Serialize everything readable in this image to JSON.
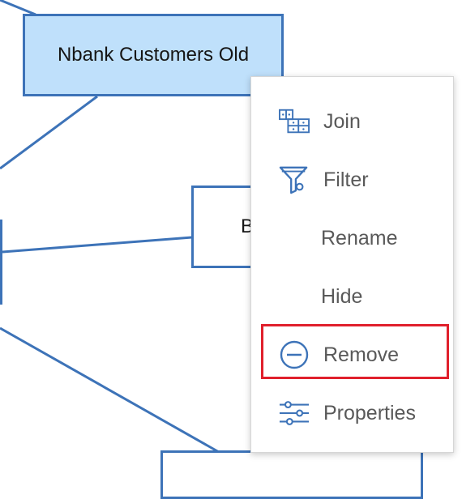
{
  "diagram": {
    "selected_node": {
      "label": "Nbank Customers Old"
    },
    "partial_node": {
      "label": "B"
    }
  },
  "context_menu": {
    "items": [
      {
        "label": "Join",
        "icon": "join-icon"
      },
      {
        "label": "Filter",
        "icon": "filter-icon"
      },
      {
        "label": "Rename",
        "icon": ""
      },
      {
        "label": "Hide",
        "icon": ""
      },
      {
        "label": "Remove",
        "icon": "remove-icon"
      },
      {
        "label": "Properties",
        "icon": "sliders-icon"
      }
    ],
    "highlighted_item": "Remove"
  },
  "colors": {
    "node_border": "#3d73b8",
    "node_selected_fill": "#bfe0fb",
    "menu_text": "#595959",
    "icon_blue": "#3d73b8",
    "highlight_red": "#e0202c"
  }
}
